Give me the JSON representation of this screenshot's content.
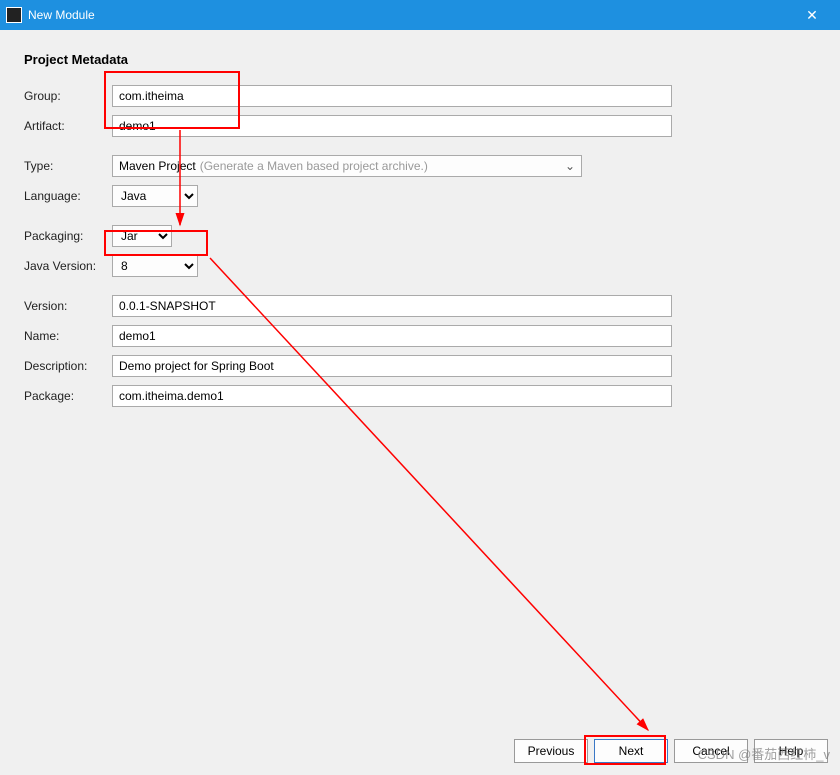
{
  "titlebar": {
    "title": "New Module"
  },
  "heading": "Project Metadata",
  "labels": {
    "group": "Group:",
    "artifact": "Artifact:",
    "type": "Type:",
    "language": "Language:",
    "packaging": "Packaging:",
    "javaVersion": "Java Version:",
    "version": "Version:",
    "name": "Name:",
    "description": "Description:",
    "package": "Package:"
  },
  "fields": {
    "group": "com.itheima",
    "artifact": "demo1",
    "type": {
      "value": "Maven Project",
      "hint": "(Generate a Maven based project archive.)"
    },
    "language": "Java",
    "packaging": "Jar",
    "javaVersion": "8",
    "version": "0.0.1-SNAPSHOT",
    "name": "demo1",
    "description": "Demo project for Spring Boot",
    "package": "com.itheima.demo1"
  },
  "buttons": {
    "previous": "Previous",
    "next": "Next",
    "cancel": "Cancel",
    "help": "Help"
  },
  "watermark": "CSDN @番茄西红柿_v"
}
